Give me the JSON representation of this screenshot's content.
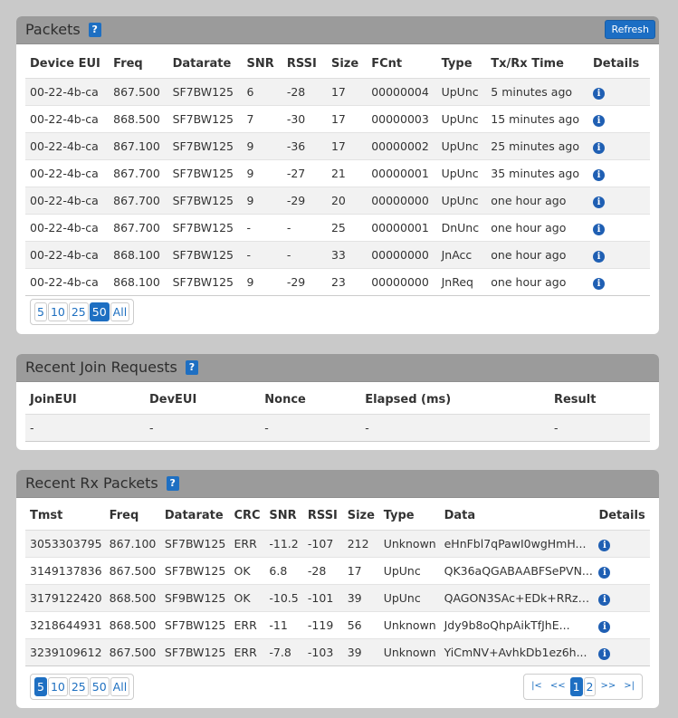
{
  "packets": {
    "title": "Packets",
    "help": "?",
    "refresh_label": "Refresh",
    "headers": [
      "Device EUI",
      "Freq",
      "Datarate",
      "SNR",
      "RSSI",
      "Size",
      "FCnt",
      "Type",
      "Tx/Rx Time",
      "Details"
    ],
    "rows": [
      [
        "00-22-4b-ca",
        "867.500",
        "SF7BW125",
        "6",
        "-28",
        "17",
        "00000004",
        "UpUnc",
        "5 minutes ago"
      ],
      [
        "00-22-4b-ca",
        "868.500",
        "SF7BW125",
        "7",
        "-30",
        "17",
        "00000003",
        "UpUnc",
        "15 minutes ago"
      ],
      [
        "00-22-4b-ca",
        "867.100",
        "SF7BW125",
        "9",
        "-36",
        "17",
        "00000002",
        "UpUnc",
        "25 minutes ago"
      ],
      [
        "00-22-4b-ca",
        "867.700",
        "SF7BW125",
        "9",
        "-27",
        "21",
        "00000001",
        "UpUnc",
        "35 minutes ago"
      ],
      [
        "00-22-4b-ca",
        "867.700",
        "SF7BW125",
        "9",
        "-29",
        "20",
        "00000000",
        "UpUnc",
        "one hour ago"
      ],
      [
        "00-22-4b-ca",
        "867.700",
        "SF7BW125",
        "-",
        "-",
        "25",
        "00000001",
        "DnUnc",
        "one hour ago"
      ],
      [
        "00-22-4b-ca",
        "868.100",
        "SF7BW125",
        "-",
        "-",
        "33",
        "00000000",
        "JnAcc",
        "one hour ago"
      ],
      [
        "00-22-4b-ca",
        "868.100",
        "SF7BW125",
        "9",
        "-29",
        "23",
        "00000000",
        "JnReq",
        "one hour ago"
      ]
    ],
    "page_sizes": [
      "5",
      "10",
      "25",
      "50",
      "All"
    ],
    "active_page_size": "50"
  },
  "join": {
    "title": "Recent Join Requests",
    "help": "?",
    "headers": [
      "JoinEUI",
      "DevEUI",
      "Nonce",
      "Elapsed (ms)",
      "Result"
    ],
    "rows": [
      [
        "-",
        "-",
        "-",
        "-",
        "-"
      ]
    ]
  },
  "rx": {
    "title": "Recent Rx Packets",
    "help": "?",
    "headers": [
      "Tmst",
      "Freq",
      "Datarate",
      "CRC",
      "SNR",
      "RSSI",
      "Size",
      "Type",
      "Data",
      "Details"
    ],
    "rows": [
      [
        "3053303795",
        "867.100",
        "SF7BW125",
        "ERR",
        "-11.2",
        "-107",
        "212",
        "Unknown",
        "eHnFbl7qPawI0wgHmH..."
      ],
      [
        "3149137836",
        "867.500",
        "SF7BW125",
        "OK",
        "6.8",
        "-28",
        "17",
        "UpUnc",
        "QK36aQGABAABFSePVN..."
      ],
      [
        "3179122420",
        "868.500",
        "SF9BW125",
        "OK",
        "-10.5",
        "-101",
        "39",
        "UpUnc",
        "QAGON3SAc+EDk+RRzz..."
      ],
      [
        "3218644931",
        "868.500",
        "SF7BW125",
        "ERR",
        "-11",
        "-119",
        "56",
        "Unknown",
        "Jdy9b8oQhpAikTfJhE..."
      ],
      [
        "3239109612",
        "867.500",
        "SF7BW125",
        "ERR",
        "-7.8",
        "-103",
        "39",
        "Unknown",
        "YiCmNV+AvhkDb1ez6h..."
      ]
    ],
    "page_sizes": [
      "5",
      "10",
      "25",
      "50",
      "All"
    ],
    "active_page_size": "5",
    "nav": [
      "|<",
      "<<",
      "1",
      "2",
      ">>",
      ">|"
    ],
    "active_page": "1"
  },
  "info_icon": "i"
}
